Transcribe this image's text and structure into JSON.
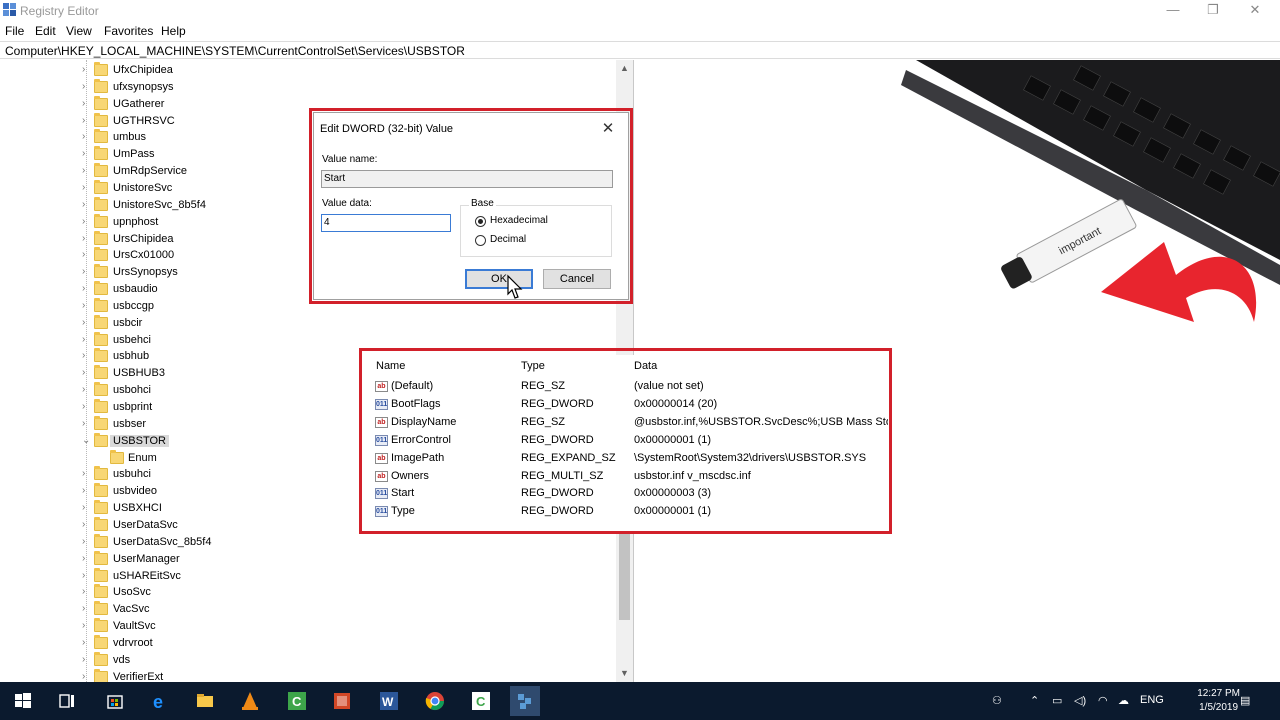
{
  "window": {
    "title": "Registry Editor"
  },
  "menu": [
    "File",
    "Edit",
    "View",
    "Favorites",
    "Help"
  ],
  "address": "Computer\\HKEY_LOCAL_MACHINE\\SYSTEM\\CurrentControlSet\\Services\\USBSTOR",
  "tree": {
    "items": [
      {
        "label": "UfxChipidea"
      },
      {
        "label": "ufxsynopsys"
      },
      {
        "label": "UGatherer"
      },
      {
        "label": "UGTHRSVC"
      },
      {
        "label": "umbus"
      },
      {
        "label": "UmPass"
      },
      {
        "label": "UmRdpService"
      },
      {
        "label": "UnistoreSvc"
      },
      {
        "label": "UnistoreSvc_8b5f4"
      },
      {
        "label": "upnphost"
      },
      {
        "label": "UrsChipidea"
      },
      {
        "label": "UrsCx01000"
      },
      {
        "label": "UrsSynopsys"
      },
      {
        "label": "usbaudio"
      },
      {
        "label": "usbccgp"
      },
      {
        "label": "usbcir"
      },
      {
        "label": "usbehci"
      },
      {
        "label": "usbhub"
      },
      {
        "label": "USBHUB3"
      },
      {
        "label": "usbohci"
      },
      {
        "label": "usbprint"
      },
      {
        "label": "usbser"
      },
      {
        "label": "USBSTOR"
      },
      {
        "label": "Enum"
      },
      {
        "label": "usbuhci"
      },
      {
        "label": "usbvideo"
      },
      {
        "label": "USBXHCI"
      },
      {
        "label": "UserDataSvc"
      },
      {
        "label": "UserDataSvc_8b5f4"
      },
      {
        "label": "UserManager"
      },
      {
        "label": "uSHAREitSvc"
      },
      {
        "label": "UsoSvc"
      },
      {
        "label": "VacSvc"
      },
      {
        "label": "VaultSvc"
      },
      {
        "label": "vdrvroot"
      },
      {
        "label": "vds"
      },
      {
        "label": "VerifierExt"
      }
    ]
  },
  "dialog": {
    "title": "Edit DWORD (32-bit) Value",
    "value_name_label": "Value name:",
    "value_name": "Start",
    "value_data_label": "Value data:",
    "value_data": "4",
    "base_label": "Base",
    "hex_label": "Hexadecimal",
    "dec_label": "Decimal",
    "ok_label": "OK",
    "cancel_label": "Cancel"
  },
  "values": {
    "headers": {
      "name": "Name",
      "type": "Type",
      "data": "Data"
    },
    "rows": [
      {
        "icon": "ab",
        "name": "(Default)",
        "type": "REG_SZ",
        "data": "(value not set)"
      },
      {
        "icon": "dword",
        "name": "BootFlags",
        "type": "REG_DWORD",
        "data": "0x00000014 (20)"
      },
      {
        "icon": "ab",
        "name": "DisplayName",
        "type": "REG_SZ",
        "data": "@usbstor.inf,%USBSTOR.SvcDesc%;USB Mass Stor..."
      },
      {
        "icon": "dword",
        "name": "ErrorControl",
        "type": "REG_DWORD",
        "data": "0x00000001 (1)"
      },
      {
        "icon": "ab",
        "name": "ImagePath",
        "type": "REG_EXPAND_SZ",
        "data": "\\SystemRoot\\System32\\drivers\\USBSTOR.SYS"
      },
      {
        "icon": "ab",
        "name": "Owners",
        "type": "REG_MULTI_SZ",
        "data": "usbstor.inf v_mscdsc.inf"
      },
      {
        "icon": "dword",
        "name": "Start",
        "type": "REG_DWORD",
        "data": "0x00000003 (3)"
      },
      {
        "icon": "dword",
        "name": "Type",
        "type": "REG_DWORD",
        "data": "0x00000001 (1)"
      }
    ]
  },
  "photo": {
    "usb_label": "important"
  },
  "taskbar": {
    "language": "ENG",
    "time": "12:27 PM",
    "date": "1/5/2019"
  },
  "colors": {
    "highlight_outline": "#d2202a",
    "taskbar": "#0b1a2e"
  }
}
